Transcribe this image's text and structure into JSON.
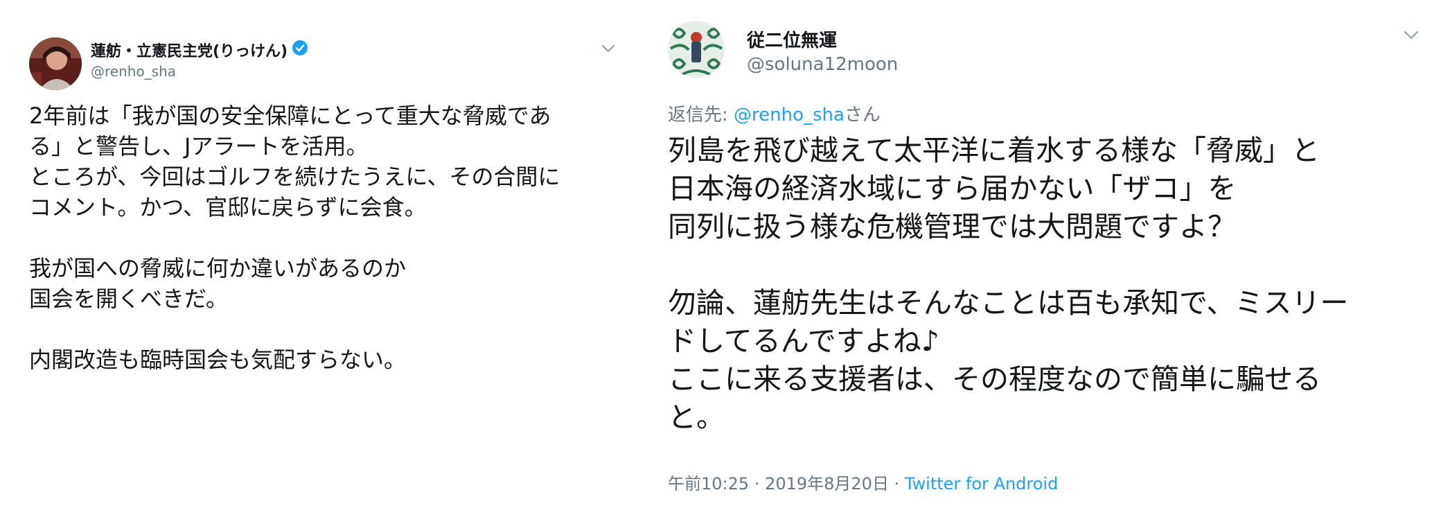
{
  "left_tweet": {
    "display_name": "蓮舫・立憲民主党(りっけん)",
    "handle": "@renho_sha",
    "body": "2年前は「我が国の安全保障にとって重大な脅威であ\nる」と警告し、Jアラートを活用。\nところが、今回はゴルフを続けたうえに、その合間に\nコメント。かつ、官邸に戻らずに会食。\n\n我が国への脅威に何か違いがあるのか\n国会を開くべきだ。\n\n内閣改造も臨時国会も気配すらない。",
    "verified_icon": "verified-badge",
    "menu_icon": "chevron-down"
  },
  "right_tweet": {
    "display_name": "従二位無運",
    "handle": "@soluna12moon",
    "reply_prefix": "返信先: ",
    "reply_mention": "@renho_sha",
    "reply_suffix": "さん",
    "body": "列島を飛び越えて太平洋に着水する様な「脅威」と\n日本海の経済水域にすら届かない「ザコ」を\n同列に扱う様な危機管理では大問題ですよ？\n\n勿論、蓮舫先生はそんなことは百も承知で、ミスリー\nドしてるんですよね♪\nここに来る支援者は、その程度なので簡単に騙せる\nと。",
    "time": "午前10:25",
    "separator": " · ",
    "date": "2019年8月20日",
    "separator2": " · ",
    "source": "Twitter for Android",
    "menu_icon": "chevron-down"
  },
  "colors": {
    "text": "#14171a",
    "secondary": "#657786",
    "link": "#1da1f2"
  }
}
